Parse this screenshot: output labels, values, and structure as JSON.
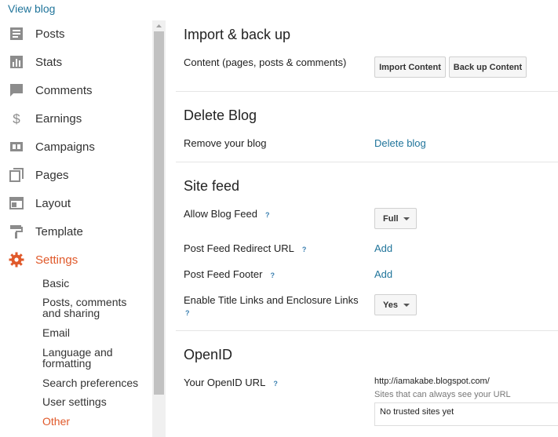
{
  "sidebar": {
    "view_blog": "View blog",
    "items": [
      {
        "label": "Posts",
        "icon": "posts-icon"
      },
      {
        "label": "Stats",
        "icon": "stats-icon"
      },
      {
        "label": "Comments",
        "icon": "comments-icon"
      },
      {
        "label": "Earnings",
        "icon": "dollar-icon"
      },
      {
        "label": "Campaigns",
        "icon": "campaigns-icon"
      },
      {
        "label": "Pages",
        "icon": "pages-icon"
      },
      {
        "label": "Layout",
        "icon": "layout-icon"
      },
      {
        "label": "Template",
        "icon": "template-icon"
      },
      {
        "label": "Settings",
        "icon": "gear-icon",
        "active": true
      }
    ],
    "sub_items": [
      {
        "label": "Basic"
      },
      {
        "label": "Posts, comments and sharing"
      },
      {
        "label": "Email"
      },
      {
        "label": "Language and formatting"
      },
      {
        "label": "Search preferences"
      },
      {
        "label": "User settings"
      },
      {
        "label": "Other",
        "active": true
      }
    ]
  },
  "import_backup": {
    "title": "Import & back up",
    "content_label": "Content (pages, posts & comments)",
    "import_button": "Import Content",
    "backup_button": "Back up Content"
  },
  "delete_blog": {
    "title": "Delete Blog",
    "remove_label": "Remove your blog",
    "delete_link": "Delete blog"
  },
  "site_feed": {
    "title": "Site feed",
    "allow_label": "Allow Blog Feed",
    "allow_value": "Full",
    "redirect_label": "Post Feed Redirect URL",
    "redirect_link": "Add",
    "footer_label": "Post Feed Footer",
    "footer_link": "Add",
    "enclosure_label": "Enable Title Links and Enclosure Links",
    "enclosure_value": "Yes",
    "help_mark": "?"
  },
  "openid": {
    "title": "OpenID",
    "url_label": "Your OpenID URL",
    "url_value": "http://iamakabe.blogspot.com/",
    "sites_caption": "Sites that can always see your URL",
    "trusted_text": "No trusted sites yet"
  },
  "colors": {
    "accent": "#e0592a",
    "link": "#21759b",
    "icon": "#8c8c8c"
  }
}
